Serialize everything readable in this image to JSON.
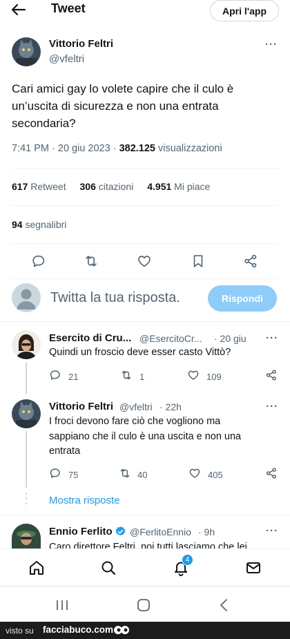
{
  "header": {
    "title": "Tweet",
    "open_app_label": "Apri l'app",
    "back_icon": "back-arrow-icon"
  },
  "tweet": {
    "author_name": "Vittorio Feltri",
    "author_handle": "@vfeltri",
    "more_label": "···",
    "text": "Cari amici gay lo volete capire che il culo  è un’uscita di sicurezza e non una entrata secondaria?",
    "time_date": "7:41 PM · 20 giu 2023 · ",
    "views_count": "382.125",
    "views_label": " visualizzazioni"
  },
  "stats": {
    "retweets_count": "617",
    "retweets_label": "Retweet",
    "quotes_count": "306",
    "quotes_label": "citazioni",
    "likes_count": "4.951",
    "likes_label": "Mi piace",
    "bookmarks_count": "94",
    "bookmarks_label": "segnalibri"
  },
  "composer": {
    "placeholder": "Twitta la tua risposta.",
    "reply_button": "Rispondi"
  },
  "replies": [
    {
      "name": "Esercito di Cru...",
      "handle": "@EsercitoCr...",
      "time": "· 20 giu",
      "text": "Quindi un froscio deve esser casto Vittò?",
      "replies": "21",
      "retweets": "1",
      "likes": "109"
    },
    {
      "name": "Vittorio Feltri",
      "handle": "@vfeltri",
      "time": "· 22h",
      "text": "I froci devono fare ciò che vogliono ma sappiano che il culo è una uscita e non una entrata",
      "replies": "75",
      "retweets": "40",
      "likes": "405"
    },
    {
      "name": "Ennio Ferlito",
      "handle": "@FerlitoEnnio",
      "time": "· 9h",
      "text": "Caro direttore Feltri, noi tutti lasciamo che lei"
    }
  ],
  "show_replies_label": "Mostra risposte",
  "bottom_nav": {
    "notifications_badge": "4"
  },
  "watermark": {
    "left": "visto su",
    "right": "facciabuco.com"
  },
  "colors": {
    "accent": "#1d9bf0",
    "reply_button_bg": "#8ecdf8",
    "muted_text": "#536471",
    "verified_badge": "#1d9bf0"
  }
}
